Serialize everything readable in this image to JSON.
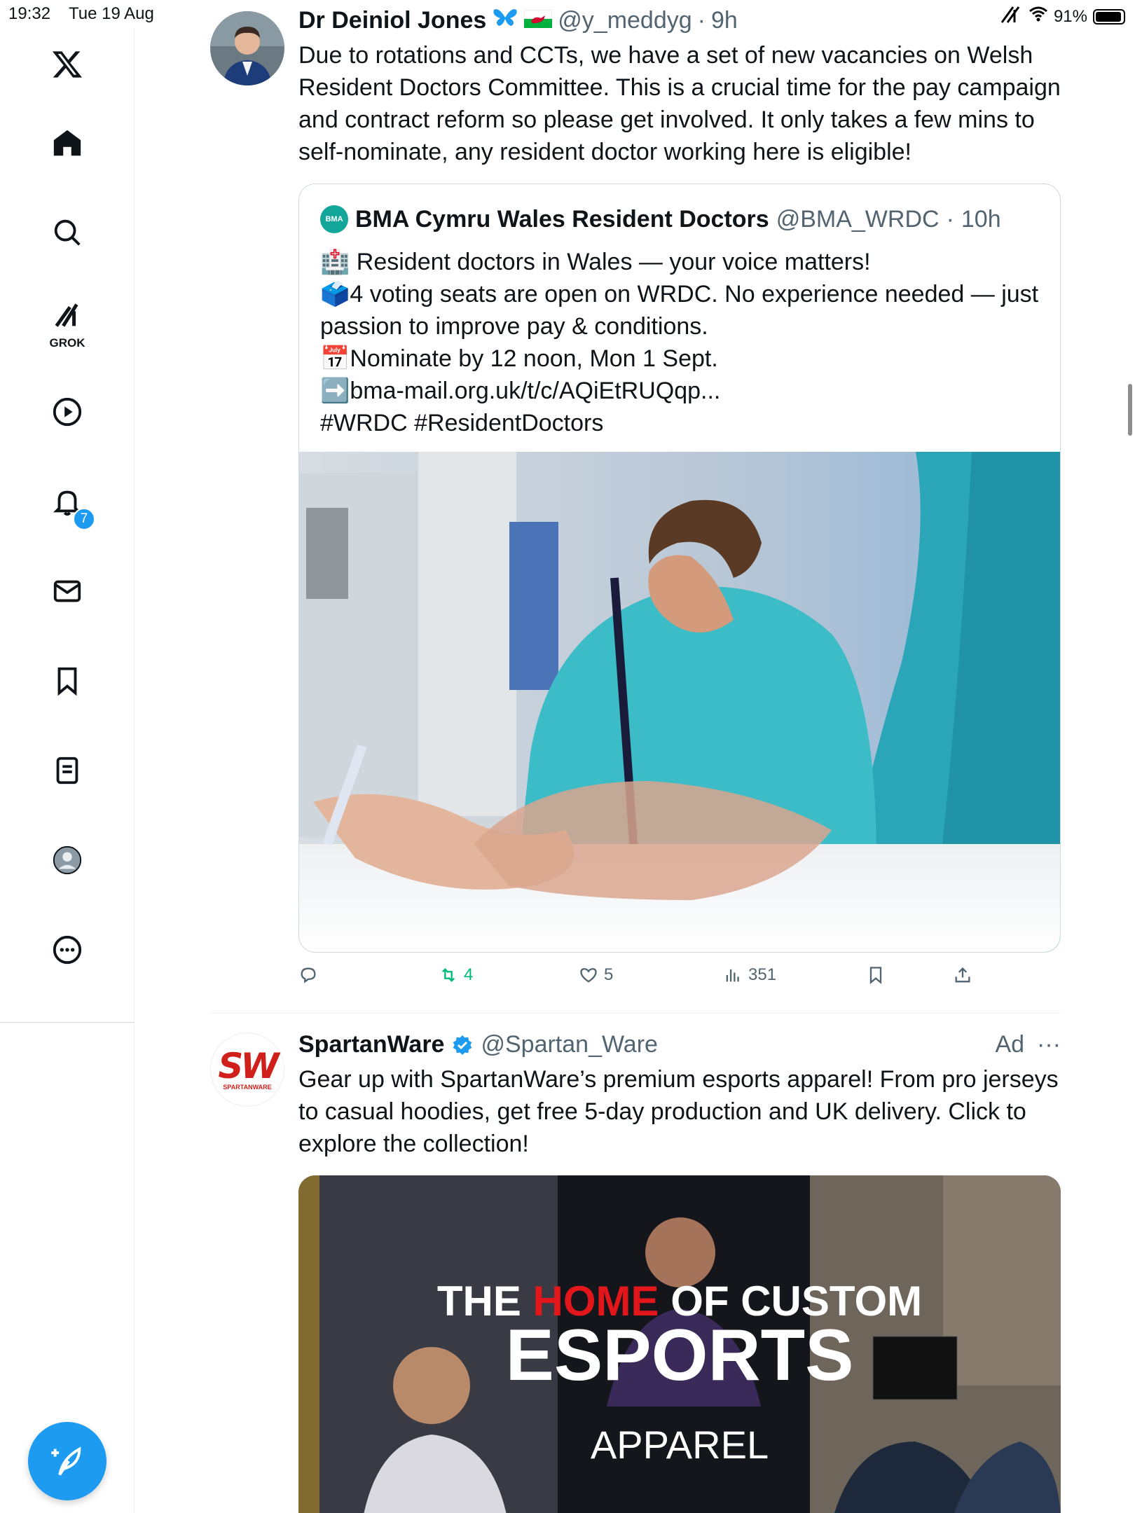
{
  "status_bar": {
    "time": "19:32",
    "date": "Tue 19 Aug",
    "battery": "91%"
  },
  "sidebar": {
    "items": [
      {
        "name": "home"
      },
      {
        "name": "search"
      },
      {
        "name": "grok",
        "label": "GROK"
      },
      {
        "name": "video"
      },
      {
        "name": "notifications",
        "badge": "7"
      },
      {
        "name": "messages"
      },
      {
        "name": "bookmarks"
      },
      {
        "name": "lists"
      },
      {
        "name": "profile"
      },
      {
        "name": "more"
      }
    ],
    "accent": "#1d9bf0"
  },
  "tweet1": {
    "author": "Dr Deiniol Jones",
    "handle": "@y_meddyg",
    "time": "9h",
    "text": "Due to rotations and CCTs, we have a set of new vacancies on Welsh Resident Doctors Committee. This is a crucial time for the pay campaign and contract reform so please get involved. It only takes a few mins to self-nominate, any resident doctor working here is eligible!",
    "quote": {
      "author": "BMA Cymru Wales Resident Doctors",
      "handle": "@BMA_WRDC",
      "time": "10h",
      "logo_text": "BMA",
      "lines": [
        "🏥 Resident doctors in Wales — your voice matters!",
        "🗳️4 voting seats are open on WRDC. No experience needed — just passion to improve pay & conditions.",
        "📅Nominate by 12 noon, Mon 1 Sept.",
        "➡️bma-mail.org.uk/t/c/AQiEtRUQqp...",
        "#WRDC #ResidentDoctors"
      ]
    },
    "actions": {
      "retweets": "4",
      "likes": "5",
      "views": "351"
    }
  },
  "ad": {
    "author": "SpartanWare",
    "handle": "@Spartan_Ware",
    "label": "Ad",
    "more": "···",
    "logo_text": "SW",
    "logo_sub": "SPARTANWARE",
    "text": "Gear up with SpartanWare’s premium esports apparel! From pro jerseys to casual hoodies, get free 5-day production and UK delivery. Click to explore the collection!",
    "image": {
      "line1_a": "THE ",
      "line1_b": "HOME",
      "line1_c": " OF CUSTOM",
      "line2": "ESPORTS",
      "line3": "APPAREL"
    }
  }
}
